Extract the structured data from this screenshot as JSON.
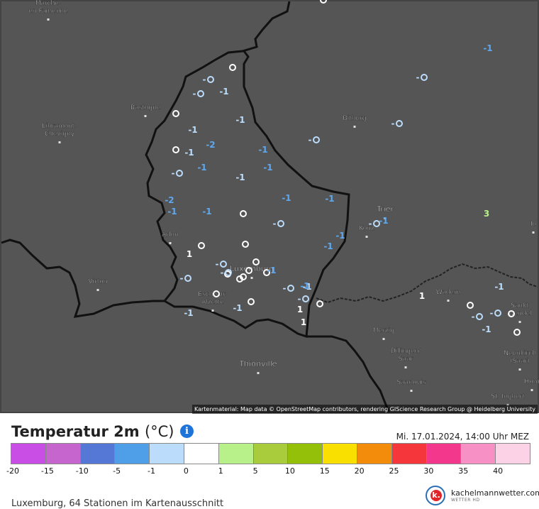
{
  "map": {
    "attribution": "Kartenmaterial: Map data © OpenStreetMap contributors, rendering GIScience Research Group @ Heidelberg University",
    "places": [
      {
        "label": "Marche-",
        "label2": "en-Famenne"
      },
      {
        "label": "Bastogne"
      },
      {
        "label": "Libramont-",
        "label2": "Chevigny"
      },
      {
        "label": "Arlon"
      },
      {
        "label": "Virton"
      },
      {
        "label": "Esch-sur-",
        "label2": "Alzette"
      },
      {
        "label": "Luxemburg"
      },
      {
        "label": "Thionville"
      },
      {
        "label": "Bitburg"
      },
      {
        "label": "Trier"
      },
      {
        "label": "Konz"
      },
      {
        "label": "Wadern"
      },
      {
        "label": "Merzig"
      },
      {
        "label": "Dillingen/",
        "label2": "Saar"
      },
      {
        "label": "Saarlouis"
      },
      {
        "label": "Sankt",
        "label2": "Wendel"
      },
      {
        "label": "Neunkirch",
        "label2": "(Saar)"
      },
      {
        "label": "St. Ingbert"
      },
      {
        "label": "Hom"
      },
      {
        "label": "Id"
      }
    ],
    "temp_values": [
      {
        "t": "-1",
        "c": "#5fa8ef"
      },
      {
        "t": "-0",
        "c": "#bcdcfb"
      },
      {
        "t": "-0",
        "c": "#bcdcfb"
      },
      {
        "t": "-0",
        "c": "#bcdcfb"
      },
      {
        "t": "-1",
        "c": "#bcdcfb"
      },
      {
        "t": "-1",
        "c": "#bcdcfb"
      },
      {
        "t": "-0",
        "c": "#bcdcfb"
      },
      {
        "t": "-0",
        "c": "#bcdcfb"
      },
      {
        "t": "-1",
        "c": "#bcdcfb"
      },
      {
        "t": "-2",
        "c": "#5fa8ef"
      },
      {
        "t": "-1",
        "c": "#5fa8ef"
      },
      {
        "t": "-1",
        "c": "#5fa8ef"
      },
      {
        "t": "-0",
        "c": "#bcdcfb"
      },
      {
        "t": "-1",
        "c": "#bcdcfb"
      },
      {
        "t": "-1",
        "c": "#5fa8ef"
      },
      {
        "t": "-2",
        "c": "#5fa8ef"
      },
      {
        "t": "-1",
        "c": "#5fa8ef"
      },
      {
        "t": "-1",
        "c": "#bcdcfb"
      },
      {
        "t": "-1",
        "c": "#5fa8ef"
      },
      {
        "t": "-1",
        "c": "#5fa8ef"
      },
      {
        "t": "-0",
        "c": "#bcdcfb"
      },
      {
        "t": "-1",
        "c": "#5fa8ef"
      },
      {
        "t": "-1",
        "c": "#5fa8ef"
      },
      {
        "t": "-1",
        "c": "#5fa8ef"
      },
      {
        "t": "-1",
        "c": "#5fa8ef"
      },
      {
        "t": "3",
        "c": "#b8f08a"
      },
      {
        "t": "1",
        "c": "#ffffff"
      },
      {
        "t": "-0",
        "c": "#bcdcfb"
      },
      {
        "t": "-1",
        "c": "#5fa8ef"
      },
      {
        "t": "-0",
        "c": "#bcdcfb"
      },
      {
        "t": "-0",
        "c": "#bcdcfb"
      },
      {
        "t": "-1",
        "c": "#bcdcfb"
      },
      {
        "t": "-1",
        "c": "#bcdcfb"
      },
      {
        "t": "-0",
        "c": "#bcdcfb"
      },
      {
        "t": "-1",
        "c": "#bcdcfb"
      },
      {
        "t": "1",
        "c": "#ffffff"
      },
      {
        "t": "1",
        "c": "#ffffff"
      },
      {
        "t": "1",
        "c": "#ffffff"
      },
      {
        "t": "-1",
        "c": "#bcdcfb"
      },
      {
        "t": "-0",
        "c": "#bcdcfb"
      },
      {
        "t": "-0",
        "c": "#bcdcfb"
      },
      {
        "t": "-1",
        "c": "#bcdcfb"
      },
      {
        "t": "-0",
        "c": "#bcdcfb"
      },
      {
        "t": "-1",
        "c": "#5fa8ef"
      },
      {
        "t": "-0",
        "c": "#bcdcfb"
      }
    ]
  },
  "legend": {
    "title": "Temperatur 2m",
    "unit": "(°C)",
    "datetime": "Mi. 17.01.2024, 14:00 Uhr MEZ",
    "colors": [
      "#c94ee6",
      "#c765cf",
      "#5577d6",
      "#4f9fe8",
      "#bcdcfb",
      "#ffffff",
      "#b8f08a",
      "#a8cc3c",
      "#95c00a",
      "#f9e000",
      "#f28c0a",
      "#f5363a",
      "#f2378c",
      "#f790c4",
      "#fcd3e6"
    ],
    "ticks": [
      "-20",
      "-15",
      "-10",
      "-5",
      "-1",
      "0",
      "1",
      "5",
      "10",
      "15",
      "20",
      "25",
      "30",
      "35",
      "40"
    ]
  },
  "footer": {
    "text": "Luxemburg, 64 Stationen im Kartenausschnitt"
  },
  "brand": {
    "name": "kachelmannwetter.com",
    "sub": "WETTER HD",
    "letter": "k."
  }
}
